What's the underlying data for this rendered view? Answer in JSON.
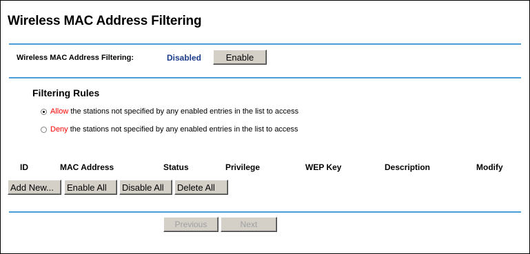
{
  "page": {
    "title": "Wireless MAC Address Filtering"
  },
  "filtering": {
    "label": "Wireless MAC Address Filtering:",
    "status": "Disabled",
    "enable_button": "Enable"
  },
  "rules": {
    "heading": "Filtering Rules",
    "options": [
      {
        "keyword": "Allow",
        "text": " the stations not specified by any enabled entries in the list to access",
        "selected": true
      },
      {
        "keyword": "Deny",
        "text": " the stations not specified by any enabled entries in the list to access",
        "selected": false
      }
    ]
  },
  "table": {
    "columns": [
      "ID",
      "MAC Address",
      "Status",
      "Privilege",
      "WEP Key",
      "Description",
      "Modify"
    ]
  },
  "actions": {
    "add_new": "Add New...",
    "enable_all": "Enable All",
    "disable_all": "Disable All",
    "delete_all": "Delete All"
  },
  "pager": {
    "previous": "Previous",
    "next": "Next"
  },
  "colors": {
    "rule": "#4a9ed8",
    "status": "#1a3a8a",
    "keyword": "#ff0000",
    "button_face": "#d4d0c8"
  }
}
